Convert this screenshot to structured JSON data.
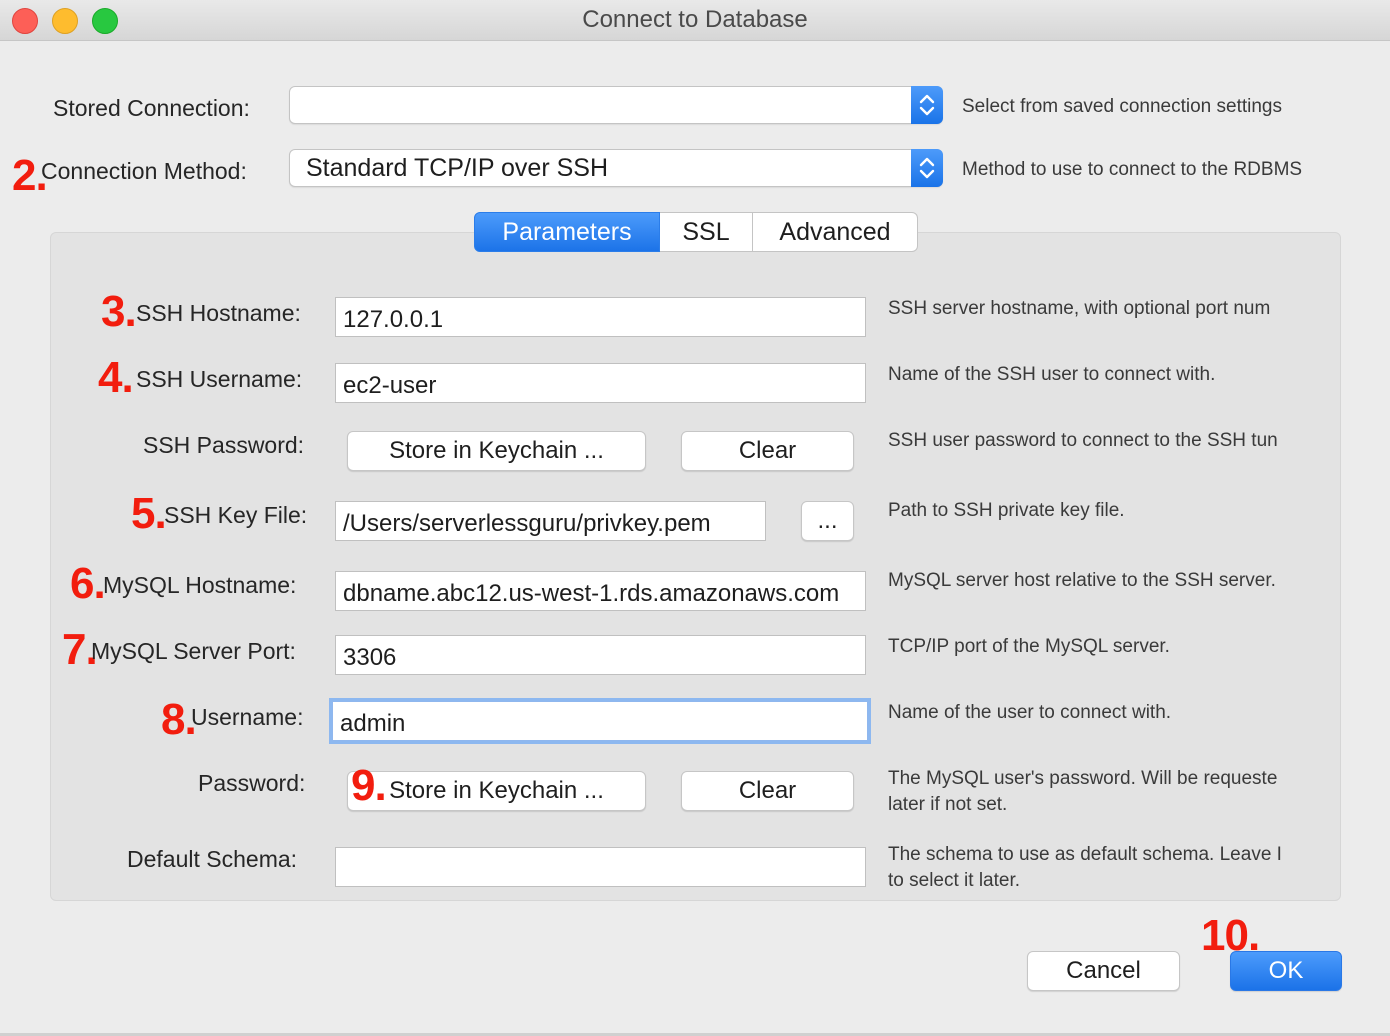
{
  "window": {
    "title": "Connect to Database"
  },
  "stored_connection": {
    "label": "Stored Connection:",
    "value": "",
    "hint": "Select from saved connection settings"
  },
  "connection_method": {
    "label": "Connection Method:",
    "value": "Standard TCP/IP over SSH",
    "hint": "Method to use to connect to the RDBMS"
  },
  "tabs": [
    {
      "label": "Parameters",
      "active": true
    },
    {
      "label": "SSL",
      "active": false
    },
    {
      "label": "Advanced",
      "active": false
    }
  ],
  "params": {
    "ssh_hostname": {
      "label": "SSH Hostname:",
      "value": "127.0.0.1",
      "hint": "SSH server hostname, with  optional port num"
    },
    "ssh_username": {
      "label": "SSH Username:",
      "value": "ec2-user",
      "hint": "Name of the SSH user to connect with."
    },
    "ssh_password": {
      "label": "SSH Password:",
      "store_label": "Store in Keychain ...",
      "clear_label": "Clear",
      "hint": "SSH user password to connect to the SSH tun"
    },
    "ssh_key_file": {
      "label": "SSH Key File:",
      "value": "/Users/serverlessguru/privkey.pem",
      "browse_label": "...",
      "hint": "Path to SSH private key file."
    },
    "mysql_hostname": {
      "label": "MySQL Hostname:",
      "value": "dbname.abc12.us-west-1.rds.amazonaws.com",
      "hint": "MySQL server host relative to the SSH server."
    },
    "mysql_port": {
      "label": "MySQL Server Port:",
      "value": "3306",
      "hint": "TCP/IP port of the MySQL server."
    },
    "username": {
      "label": "Username:",
      "value": "admin",
      "hint": "Name of the user to connect with."
    },
    "password": {
      "label": "Password:",
      "store_label": "Store in Keychain ...",
      "clear_label": "Clear",
      "hint_line1": "The MySQL user's password. Will be requeste",
      "hint_line2": "later if not set."
    },
    "default_schema": {
      "label": "Default Schema:",
      "value": "",
      "hint_line1": "The schema to use as default schema. Leave I",
      "hint_line2": "to select it later."
    }
  },
  "footer": {
    "cancel_label": "Cancel",
    "ok_label": "OK"
  },
  "annotations": {
    "n2": "2.",
    "n3": "3.",
    "n4": "4.",
    "n5": "5.",
    "n6": "6.",
    "n7": "7.",
    "n8": "8.",
    "n9": "9.",
    "n10": "10."
  },
  "colors": {
    "accent": "#1c73e8",
    "annotation": "#f21d0e",
    "window_bg": "#ececec"
  }
}
